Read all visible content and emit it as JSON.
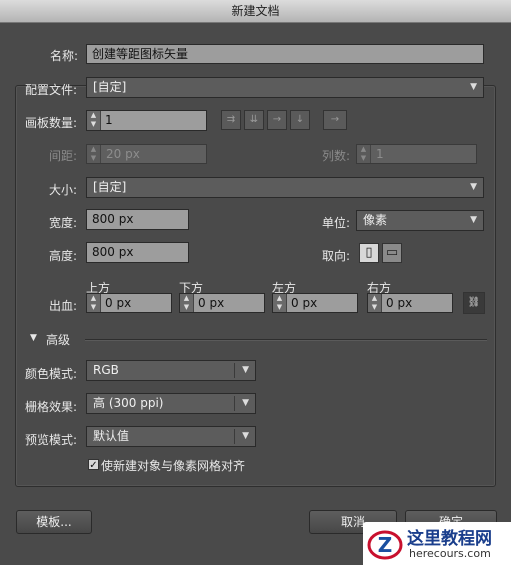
{
  "window": {
    "title": "新建文档"
  },
  "name": {
    "label": "名称:",
    "value": "创建等距图标矢量"
  },
  "profile": {
    "label": "配置文件:",
    "value": "[自定]"
  },
  "artboards": {
    "label": "画板数量:",
    "value": "1"
  },
  "spacing": {
    "label": "间距:",
    "value": "20 px"
  },
  "columns": {
    "label": "列数:",
    "value": "1"
  },
  "size": {
    "label": "大小:",
    "value": "[自定]"
  },
  "width": {
    "label": "宽度:",
    "value": "800 px"
  },
  "height": {
    "label": "高度:",
    "value": "800 px"
  },
  "units": {
    "label": "单位:",
    "value": "像素"
  },
  "orientation": {
    "label": "取向:"
  },
  "bleed": {
    "label": "出血:",
    "top": {
      "label": "上方",
      "value": "0 px"
    },
    "bottom": {
      "label": "下方",
      "value": "0 px"
    },
    "left": {
      "label": "左方",
      "value": "0 px"
    },
    "right": {
      "label": "右方",
      "value": "0 px"
    }
  },
  "advanced": {
    "label": "高级"
  },
  "color_mode": {
    "label": "颜色模式:",
    "value": "RGB"
  },
  "raster": {
    "label": "栅格效果:",
    "value": "高 (300 ppi)"
  },
  "preview": {
    "label": "预览模式:",
    "value": "默认值"
  },
  "align_pixel": {
    "label": "使新建对象与像素网格对齐",
    "checked": true
  },
  "buttons": {
    "templates": "模板...",
    "cancel": "取消",
    "ok": "确定"
  },
  "watermark": {
    "text": "这里教程网",
    "url": "herecours.com"
  }
}
